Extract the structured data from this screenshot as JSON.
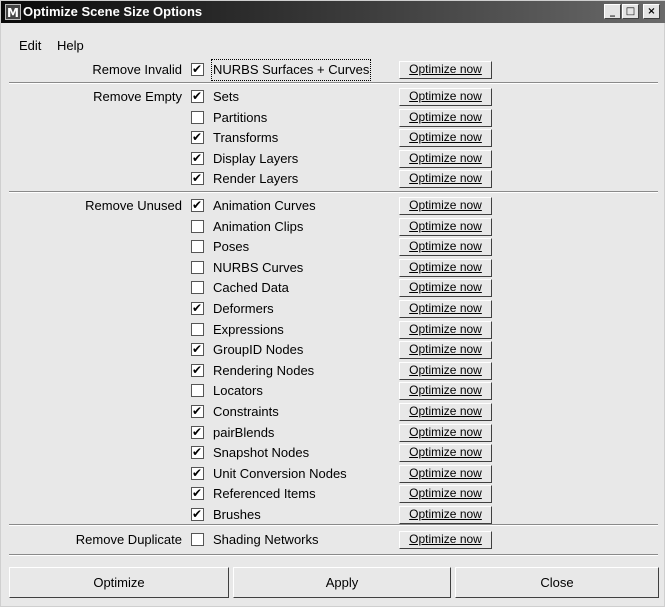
{
  "window": {
    "title": "Optimize Scene Size Options",
    "controls": {
      "minimize": "_",
      "maximize": "□",
      "close": "×"
    }
  },
  "menu": {
    "edit": "Edit",
    "help": "Help"
  },
  "sections": [
    {
      "label": "Remove Invalid",
      "items": [
        {
          "label": "NURBS Surfaces + Curves",
          "checked": true,
          "button": "Optimize now"
        }
      ]
    },
    {
      "label": "Remove Empty",
      "items": [
        {
          "label": "Sets",
          "checked": true,
          "button": "Optimize now"
        },
        {
          "label": "Partitions",
          "checked": false,
          "button": "Optimize now"
        },
        {
          "label": "Transforms",
          "checked": true,
          "button": "Optimize now"
        },
        {
          "label": "Display Layers",
          "checked": true,
          "button": "Optimize now"
        },
        {
          "label": "Render Layers",
          "checked": true,
          "button": "Optimize now"
        }
      ]
    },
    {
      "label": "Remove Unused",
      "items": [
        {
          "label": "Animation Curves",
          "checked": true,
          "button": "Optimize now"
        },
        {
          "label": "Animation Clips",
          "checked": false,
          "button": "Optimize now"
        },
        {
          "label": "Poses",
          "checked": false,
          "button": "Optimize now"
        },
        {
          "label": "NURBS Curves",
          "checked": false,
          "button": "Optimize now"
        },
        {
          "label": "Cached Data",
          "checked": false,
          "button": "Optimize now"
        },
        {
          "label": "Deformers",
          "checked": true,
          "button": "Optimize now"
        },
        {
          "label": "Expressions",
          "checked": false,
          "button": "Optimize now"
        },
        {
          "label": "GroupID Nodes",
          "checked": true,
          "button": "Optimize now"
        },
        {
          "label": "Rendering Nodes",
          "checked": true,
          "button": "Optimize now"
        },
        {
          "label": "Locators",
          "checked": false,
          "button": "Optimize now"
        },
        {
          "label": "Constraints",
          "checked": true,
          "button": "Optimize now"
        },
        {
          "label": "pairBlends",
          "checked": true,
          "button": "Optimize now"
        },
        {
          "label": "Snapshot Nodes",
          "checked": true,
          "button": "Optimize now"
        },
        {
          "label": "Unit Conversion Nodes",
          "checked": true,
          "button": "Optimize now"
        },
        {
          "label": "Referenced Items",
          "checked": true,
          "button": "Optimize now"
        },
        {
          "label": "Brushes",
          "checked": true,
          "button": "Optimize now"
        }
      ]
    },
    {
      "label": "Remove Duplicate",
      "items": [
        {
          "label": "Shading Networks",
          "checked": false,
          "button": "Optimize now"
        }
      ]
    }
  ],
  "buttons": {
    "optimize": "Optimize",
    "apply": "Apply",
    "close": "Close"
  }
}
